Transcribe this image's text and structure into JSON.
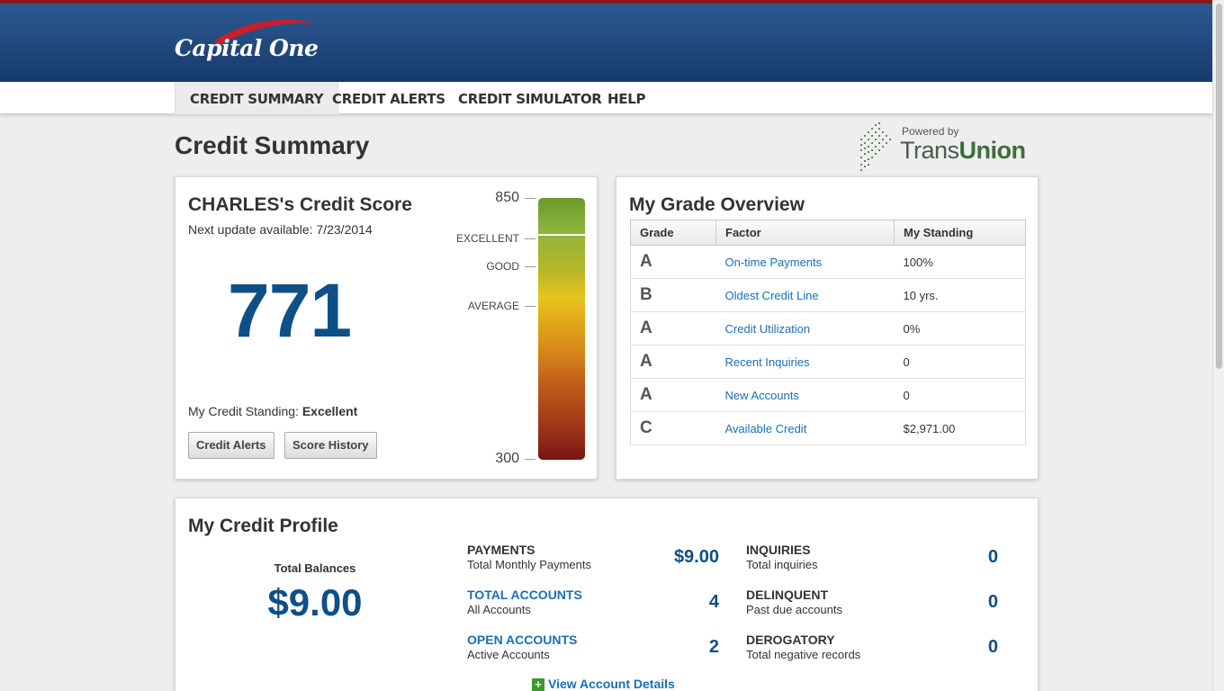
{
  "brand": {
    "logo_text": "Capital One"
  },
  "nav": {
    "items": [
      {
        "label": "CREDIT SUMMARY",
        "active": true
      },
      {
        "label": "CREDIT ALERTS"
      },
      {
        "label": "CREDIT SIMULATOR"
      },
      {
        "label": "HELP"
      }
    ]
  },
  "page": {
    "title": "Credit Summary"
  },
  "partner": {
    "powered_by": "Powered by",
    "name_prefix": "Trans",
    "name_suffix": "Union"
  },
  "score_card": {
    "title": "CHARLES's Credit Score",
    "next_update": "Next update available: 7/23/2014",
    "score": "771",
    "standing_label": "My Credit Standing:",
    "standing_value": "Excellent",
    "buttons": {
      "alerts": "Credit Alerts",
      "history": "Score History"
    },
    "gauge": {
      "max": "850",
      "min": "300",
      "labels": {
        "excellent": "EXCELLENT",
        "good": "GOOD",
        "average": "AVERAGE"
      }
    }
  },
  "grade_card": {
    "title": "My Grade Overview",
    "columns": [
      "Grade",
      "Factor",
      "My Standing"
    ],
    "rows": [
      {
        "grade": "A",
        "factor": "On-time Payments",
        "standing": "100%"
      },
      {
        "grade": "B",
        "factor": "Oldest Credit Line",
        "standing": "10 yrs."
      },
      {
        "grade": "A",
        "factor": "Credit Utilization",
        "standing": "0%"
      },
      {
        "grade": "A",
        "factor": "Recent Inquiries",
        "standing": "0"
      },
      {
        "grade": "A",
        "factor": "New Accounts",
        "standing": "0"
      },
      {
        "grade": "C",
        "factor": "Available Credit",
        "standing": "$2,971.00"
      }
    ]
  },
  "profile": {
    "title": "My Credit Profile",
    "total_balances_label": "Total Balances",
    "total_balances_value": "$9.00",
    "stats": {
      "payments": {
        "head": "PAYMENTS",
        "sub": "Total Monthly Payments",
        "value": "$9.00"
      },
      "total_accounts": {
        "head": "TOTAL ACCOUNTS",
        "sub": "All Accounts",
        "value": "4"
      },
      "open_accounts": {
        "head": "OPEN ACCOUNTS",
        "sub": "Active Accounts",
        "value": "2"
      },
      "inquiries": {
        "head": "INQUIRIES",
        "sub": "Total inquiries",
        "value": "0"
      },
      "delinquent": {
        "head": "DELINQUENT",
        "sub": "Past due accounts",
        "value": "0"
      },
      "derogatory": {
        "head": "DEROGATORY",
        "sub": "Total negative records",
        "value": "0"
      }
    },
    "view_details": "View Account Details"
  },
  "colors": {
    "brand_blue": "#173a6a",
    "score_blue": "#0f4f87",
    "link_blue": "#1a6fb5",
    "accent_red": "#8b1a1a"
  },
  "icons": [
    "capital-one-swoosh-icon",
    "transunion-logo-icon",
    "plus-icon"
  ]
}
